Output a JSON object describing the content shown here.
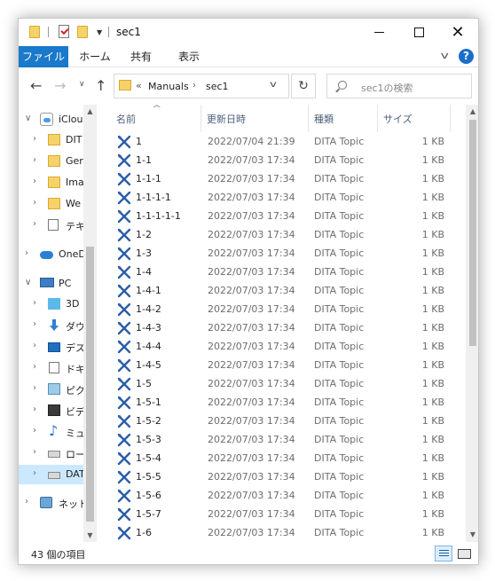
{
  "window": {
    "title": "sec1"
  },
  "ribbon": {
    "tabs": [
      "ファイル",
      "ホーム",
      "共有",
      "表示"
    ]
  },
  "address": {
    "segments": [
      "Manuals",
      "sec1"
    ],
    "search_placeholder": "sec1の検索"
  },
  "navpane": {
    "items": [
      {
        "label": "iClou",
        "icon": "icloud-icon"
      },
      {
        "label": "DIT",
        "icon": "folder-icon"
      },
      {
        "label": "Ger",
        "icon": "folder-icon"
      },
      {
        "label": "Ima",
        "icon": "folder-icon"
      },
      {
        "label": "We",
        "icon": "folder-icon"
      },
      {
        "label": "テキ",
        "icon": "text-file-icon"
      },
      {
        "label": "OneD",
        "icon": "onedrive-cloud-icon"
      },
      {
        "label": "PC",
        "icon": "pc-icon"
      },
      {
        "label": "3D",
        "icon": "3d-objects-icon"
      },
      {
        "label": "ダウ",
        "icon": "downloads-icon"
      },
      {
        "label": "デス",
        "icon": "desktop-icon"
      },
      {
        "label": "ドキ",
        "icon": "documents-icon"
      },
      {
        "label": "ピク",
        "icon": "pictures-icon"
      },
      {
        "label": "ビデ",
        "icon": "videos-icon"
      },
      {
        "label": "ミュ",
        "icon": "music-icon"
      },
      {
        "label": "ロー",
        "icon": "local-disk-icon"
      },
      {
        "label": "DAT",
        "icon": "data-drive-icon"
      },
      {
        "label": "ネット",
        "icon": "network-icon"
      }
    ]
  },
  "filelist": {
    "columns": [
      "名前",
      "更新日時",
      "種類",
      "サイズ"
    ],
    "rows": [
      {
        "name": "1",
        "date": "2022/07/04 21:39",
        "type": "DITA Topic",
        "size": "1 KB"
      },
      {
        "name": "1-1",
        "date": "2022/07/03 17:34",
        "type": "DITA Topic",
        "size": "1 KB"
      },
      {
        "name": "1-1-1",
        "date": "2022/07/03 17:34",
        "type": "DITA Topic",
        "size": "1 KB"
      },
      {
        "name": "1-1-1-1",
        "date": "2022/07/03 17:34",
        "type": "DITA Topic",
        "size": "1 KB"
      },
      {
        "name": "1-1-1-1-1",
        "date": "2022/07/03 17:34",
        "type": "DITA Topic",
        "size": "1 KB"
      },
      {
        "name": "1-2",
        "date": "2022/07/03 17:34",
        "type": "DITA Topic",
        "size": "1 KB"
      },
      {
        "name": "1-3",
        "date": "2022/07/03 17:34",
        "type": "DITA Topic",
        "size": "1 KB"
      },
      {
        "name": "1-4",
        "date": "2022/07/03 17:34",
        "type": "DITA Topic",
        "size": "1 KB"
      },
      {
        "name": "1-4-1",
        "date": "2022/07/03 17:34",
        "type": "DITA Topic",
        "size": "1 KB"
      },
      {
        "name": "1-4-2",
        "date": "2022/07/03 17:34",
        "type": "DITA Topic",
        "size": "1 KB"
      },
      {
        "name": "1-4-3",
        "date": "2022/07/03 17:34",
        "type": "DITA Topic",
        "size": "1 KB"
      },
      {
        "name": "1-4-4",
        "date": "2022/07/03 17:34",
        "type": "DITA Topic",
        "size": "1 KB"
      },
      {
        "name": "1-4-5",
        "date": "2022/07/03 17:34",
        "type": "DITA Topic",
        "size": "1 KB"
      },
      {
        "name": "1-5",
        "date": "2022/07/03 17:34",
        "type": "DITA Topic",
        "size": "1 KB"
      },
      {
        "name": "1-5-1",
        "date": "2022/07/03 17:34",
        "type": "DITA Topic",
        "size": "1 KB"
      },
      {
        "name": "1-5-2",
        "date": "2022/07/03 17:34",
        "type": "DITA Topic",
        "size": "1 KB"
      },
      {
        "name": "1-5-3",
        "date": "2022/07/03 17:34",
        "type": "DITA Topic",
        "size": "1 KB"
      },
      {
        "name": "1-5-4",
        "date": "2022/07/03 17:34",
        "type": "DITA Topic",
        "size": "1 KB"
      },
      {
        "name": "1-5-5",
        "date": "2022/07/03 17:34",
        "type": "DITA Topic",
        "size": "1 KB"
      },
      {
        "name": "1-5-6",
        "date": "2022/07/03 17:34",
        "type": "DITA Topic",
        "size": "1 KB"
      },
      {
        "name": "1-5-7",
        "date": "2022/07/03 17:34",
        "type": "DITA Topic",
        "size": "1 KB"
      },
      {
        "name": "1-6",
        "date": "2022/07/03 17:34",
        "type": "DITA Topic",
        "size": "1 KB"
      }
    ]
  },
  "status": {
    "item_count": "43 個の項目"
  },
  "colors": {
    "accent": "#1979ca",
    "selection": "#cce8ff",
    "dita_icon": "#2b5ea7"
  }
}
